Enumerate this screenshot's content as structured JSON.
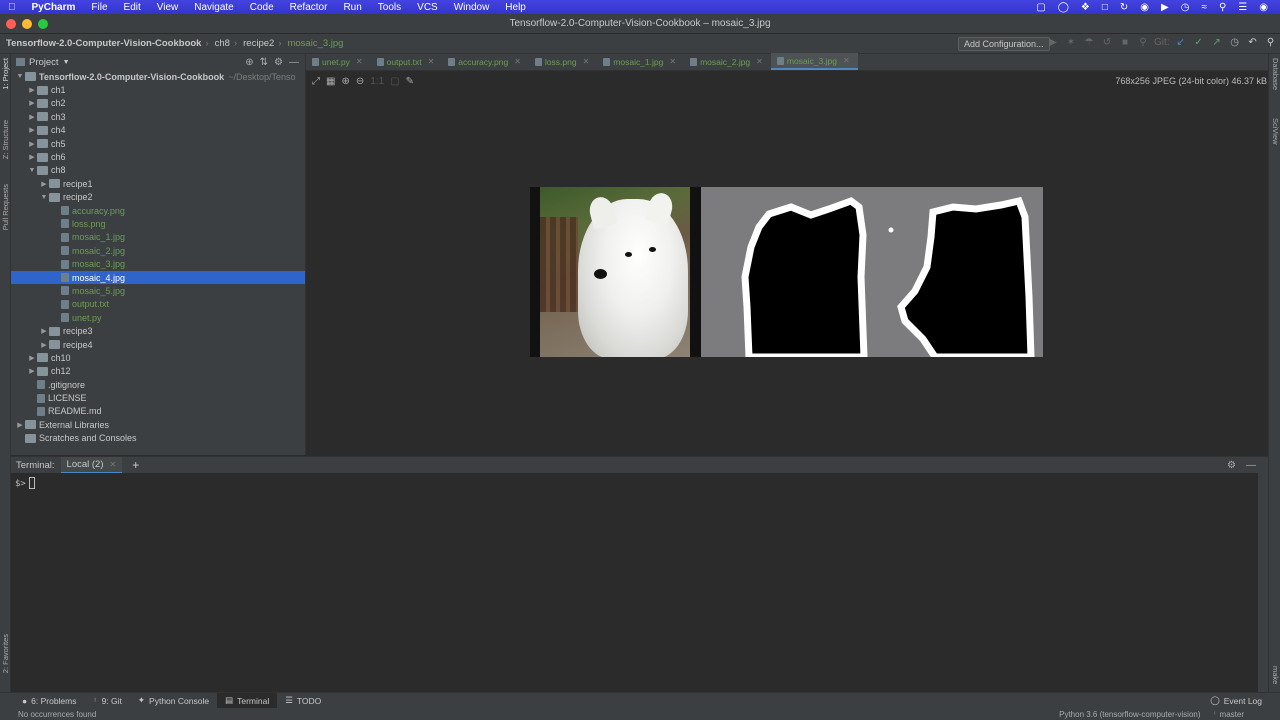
{
  "menubar": {
    "app": "PyCharm",
    "items": [
      "File",
      "Edit",
      "View",
      "Navigate",
      "Code",
      "Refactor",
      "Run",
      "Tools",
      "VCS",
      "Window",
      "Help"
    ]
  },
  "window": {
    "title": "Tensorflow-2.0-Computer-Vision-Cookbook – mosaic_3.jpg",
    "dots": [
      "#ff5f57",
      "#febc2e",
      "#28c840"
    ]
  },
  "breadcrumb": [
    "Tensorflow-2.0-Computer-Vision-Cookbook",
    "ch8",
    "recipe2",
    "mosaic_3.jpg"
  ],
  "navbar": {
    "add_configuration": "Add Configuration...",
    "git_label": "Git:"
  },
  "side_labels": {
    "left": [
      "1: Project",
      "Z: Structure",
      "Pull Requests",
      "2: Favorites"
    ],
    "right": [
      "Database",
      "SciView",
      "make"
    ]
  },
  "project_panel": {
    "title": "Project",
    "tree": [
      {
        "label": "Tensorflow-2.0-Computer-Vision-Cookbook",
        "path": "~/Desktop/Tenso",
        "depth": 0,
        "kind": "folder",
        "open": true,
        "bold": true
      },
      {
        "label": "ch1",
        "depth": 1,
        "kind": "folder"
      },
      {
        "label": "ch2",
        "depth": 1,
        "kind": "folder"
      },
      {
        "label": "ch3",
        "depth": 1,
        "kind": "folder"
      },
      {
        "label": "ch4",
        "depth": 1,
        "kind": "folder"
      },
      {
        "label": "ch5",
        "depth": 1,
        "kind": "folder"
      },
      {
        "label": "ch6",
        "depth": 1,
        "kind": "folder"
      },
      {
        "label": "ch8",
        "depth": 1,
        "kind": "folder",
        "open": true
      },
      {
        "label": "recipe1",
        "depth": 2,
        "kind": "folder"
      },
      {
        "label": "recipe2",
        "depth": 2,
        "kind": "folder",
        "open": true
      },
      {
        "label": "accuracy.png",
        "depth": 3,
        "kind": "file",
        "green": true
      },
      {
        "label": "loss.png",
        "depth": 3,
        "kind": "file",
        "green": true
      },
      {
        "label": "mosaic_1.jpg",
        "depth": 3,
        "kind": "file",
        "green": true
      },
      {
        "label": "mosaic_2.jpg",
        "depth": 3,
        "kind": "file",
        "green": true
      },
      {
        "label": "mosaic_3.jpg",
        "depth": 3,
        "kind": "file",
        "green": true
      },
      {
        "label": "mosaic_4.jpg",
        "depth": 3,
        "kind": "file",
        "green": true,
        "selected": true
      },
      {
        "label": "mosaic_5.jpg",
        "depth": 3,
        "kind": "file",
        "green": true
      },
      {
        "label": "output.txt",
        "depth": 3,
        "kind": "file",
        "green": true
      },
      {
        "label": "unet.py",
        "depth": 3,
        "kind": "file",
        "green": true
      },
      {
        "label": "recipe3",
        "depth": 2,
        "kind": "folder"
      },
      {
        "label": "recipe4",
        "depth": 2,
        "kind": "folder"
      },
      {
        "label": "ch10",
        "depth": 1,
        "kind": "folder"
      },
      {
        "label": "ch12",
        "depth": 1,
        "kind": "folder"
      },
      {
        "label": ".gitignore",
        "depth": 1,
        "kind": "file"
      },
      {
        "label": "LICENSE",
        "depth": 1,
        "kind": "file"
      },
      {
        "label": "README.md",
        "depth": 1,
        "kind": "file"
      },
      {
        "label": "External Libraries",
        "depth": 0,
        "kind": "lib"
      },
      {
        "label": "Scratches and Consoles",
        "depth": 0,
        "kind": "scratch",
        "noarrow": true
      }
    ]
  },
  "editor_tabs": [
    {
      "label": "unet.py"
    },
    {
      "label": "output.txt"
    },
    {
      "label": "accuracy.png"
    },
    {
      "label": "loss.png"
    },
    {
      "label": "mosaic_1.jpg"
    },
    {
      "label": "mosaic_2.jpg"
    },
    {
      "label": "mosaic_3.jpg",
      "active": true
    }
  ],
  "image_info": "768x256 JPEG (24-bit color) 46.37 kB",
  "terminal": {
    "label": "Terminal:",
    "tab": "Local (2)",
    "prompt": "$>"
  },
  "bottom_tools": [
    {
      "label": "6: Problems",
      "icon": "problems-icon"
    },
    {
      "label": "9: Git",
      "icon": "git-icon"
    },
    {
      "label": "Python Console",
      "icon": "python-icon"
    },
    {
      "label": "Terminal",
      "icon": "terminal-icon",
      "active": true
    },
    {
      "label": "TODO",
      "icon": "todo-icon"
    }
  ],
  "event_log": "Event Log",
  "status": {
    "left": "No occurrences found",
    "interpreter": "Python 3.6 (tensorflow-computer-vision)",
    "branch": "master"
  }
}
